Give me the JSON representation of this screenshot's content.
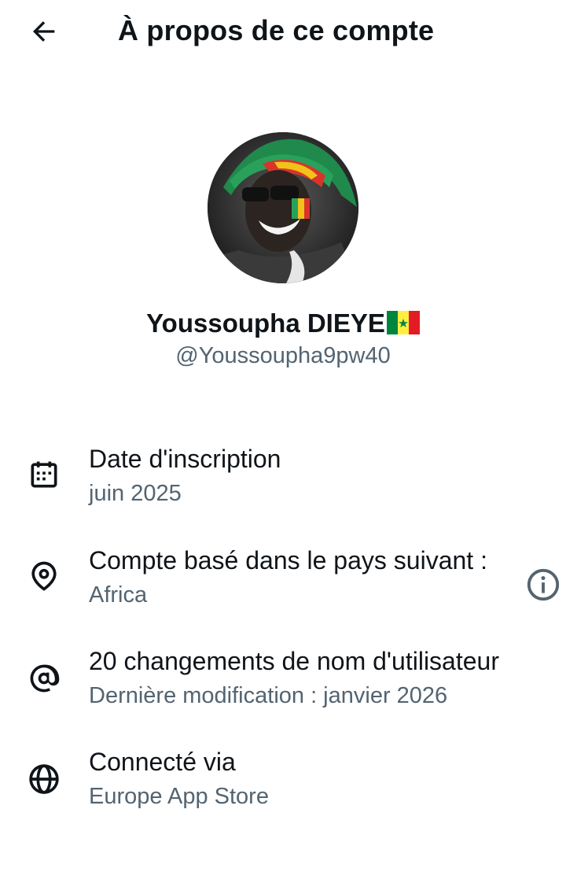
{
  "header": {
    "title": "À propos de ce compte",
    "back_icon": "arrow-left-icon"
  },
  "profile": {
    "display_name": "Youssoupha DIEYE",
    "flag_icon": "senegal-flag-emoji",
    "handle": "@Youssoupha9pw40"
  },
  "details": [
    {
      "icon": "calendar-icon",
      "label": "Date d'inscription",
      "value": "juin 2025"
    },
    {
      "icon": "location-pin-icon",
      "label": "Compte basé dans le pays suivant :",
      "value": "Africa",
      "action_icon": "info-icon"
    },
    {
      "icon": "at-sign-icon",
      "label": "20 changements de nom d'utilisateur",
      "value": "Dernière modification : janvier 2026"
    },
    {
      "icon": "globe-icon",
      "label": "Connecté via",
      "value": "Europe App Store"
    }
  ],
  "colors": {
    "text_primary": "#0f1419",
    "text_secondary": "#536471",
    "background": "#ffffff"
  }
}
